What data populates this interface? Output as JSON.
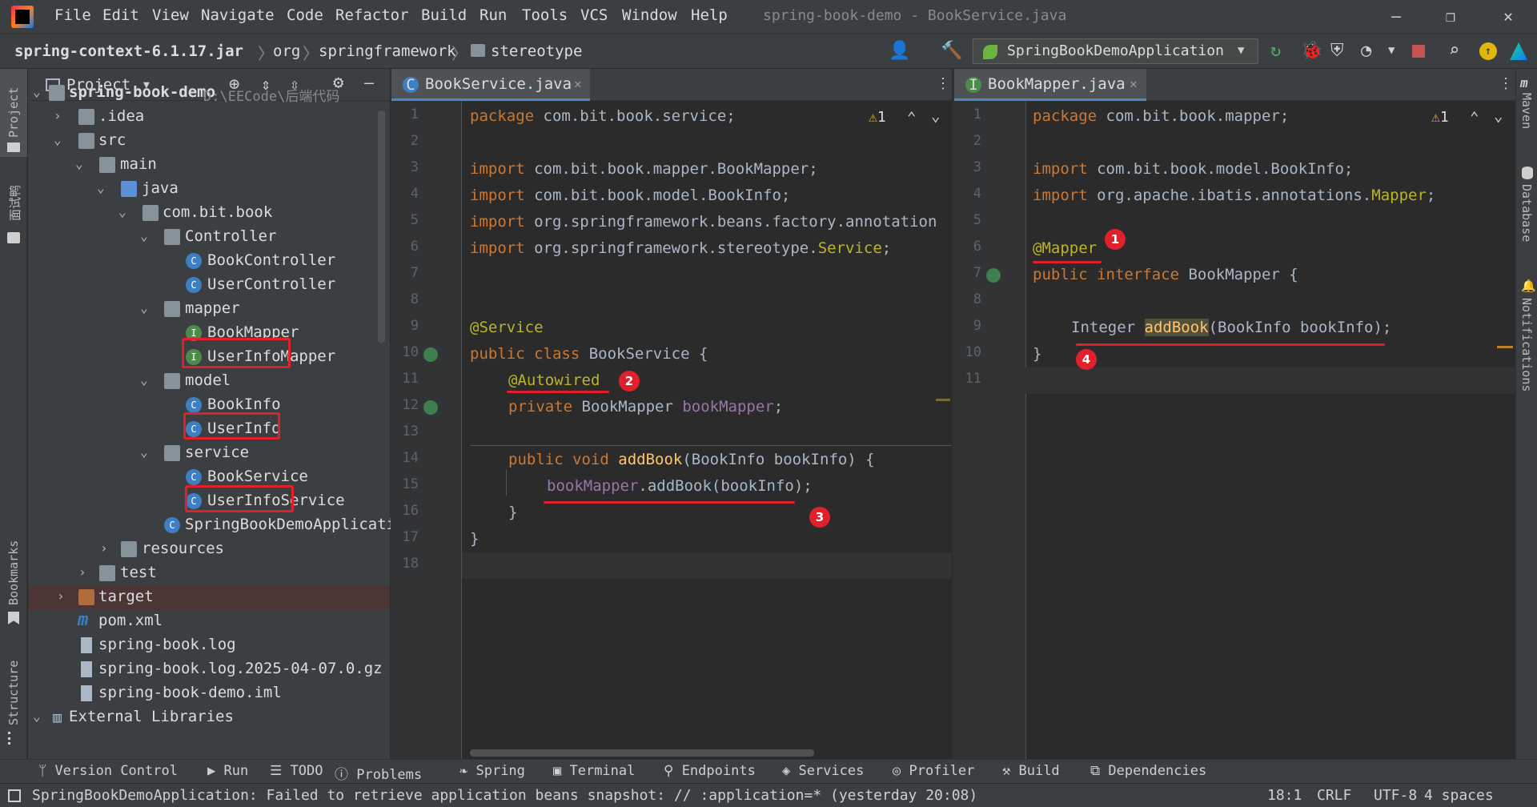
{
  "menu": [
    "File",
    "Edit",
    "View",
    "Navigate",
    "Code",
    "Refactor",
    "Build",
    "Run",
    "Tools",
    "VCS",
    "Window",
    "Help"
  ],
  "window_title": "spring-book-demo - BookService.java",
  "breadcrumb": [
    "spring-context-6.1.17.jar",
    "org",
    "springframework",
    "stereotype"
  ],
  "run_config": "SpringBookDemoApplication",
  "project_panel": {
    "title": "Project",
    "tree": [
      {
        "label": "spring-book-demo",
        "path": "D:\\EECode\\后端代码"
      },
      {
        "label": ".idea"
      },
      {
        "label": "src"
      },
      {
        "label": "main"
      },
      {
        "label": "java"
      },
      {
        "label": "com.bit.book"
      },
      {
        "label": "Controller"
      },
      {
        "label": "BookController"
      },
      {
        "label": "UserController"
      },
      {
        "label": "mapper"
      },
      {
        "label": "BookMapper"
      },
      {
        "label": "UserInfoMapper"
      },
      {
        "label": "model"
      },
      {
        "label": "BookInfo"
      },
      {
        "label": "UserInfo"
      },
      {
        "label": "service"
      },
      {
        "label": "BookService"
      },
      {
        "label": "UserInfoService"
      },
      {
        "label": "SpringBookDemoApplicati"
      },
      {
        "label": "resources"
      },
      {
        "label": "test"
      },
      {
        "label": "target"
      },
      {
        "label": "pom.xml"
      },
      {
        "label": "spring-book.log"
      },
      {
        "label": "spring-book.log.2025-04-07.0.gz"
      },
      {
        "label": "spring-book-demo.iml"
      },
      {
        "label": "External Libraries"
      }
    ]
  },
  "left_editor": {
    "tab": "BookService.java",
    "warnings": "1",
    "line_numbers": [
      "1",
      "2",
      "3",
      "4",
      "5",
      "6",
      "7",
      "8",
      "9",
      "10",
      "11",
      "12",
      "13",
      "14",
      "15",
      "16",
      "17",
      "18"
    ],
    "lines": {
      "l1_kw": "package",
      "l1_rest": " com.bit.book.service;",
      "l3_kw": "import",
      "l3_rest": " com.bit.book.mapper.BookMapper;",
      "l4_kw": "import",
      "l4_rest": " com.bit.book.model.BookInfo;",
      "l5_kw": "import",
      "l5_rest": " org.springframework.beans.factory.annotation",
      "l6_kw": "import",
      "l6_rest": " org.springframework.stereotype.",
      "l6_ann": "Service",
      "l6_end": ";",
      "l9_ann": "@Service",
      "l10_kw": "public class",
      "l10_rest": " BookService {",
      "l11_ann": "@Autowired",
      "l12_kw": "private",
      "l12_type": " BookMapper ",
      "l12_fld": "bookMapper",
      "l12_end": ";",
      "l14_kw": "public void",
      "l14_mth": " addBook",
      "l14_rest": "(BookInfo bookInfo) {",
      "l15_fld": "bookMapper",
      "l15_rest": ".addBook(bookInfo);",
      "l16": "}",
      "l17": "}"
    },
    "badges": [
      "2",
      "3"
    ]
  },
  "right_editor": {
    "tab": "BookMapper.java",
    "warnings": "1",
    "line_numbers": [
      "1",
      "2",
      "3",
      "4",
      "5",
      "6",
      "7",
      "8",
      "9",
      "10",
      "11"
    ],
    "lines": {
      "l1_kw": "package",
      "l1_rest": " com.bit.book.mapper;",
      "l3_kw": "import",
      "l3_rest": " com.bit.book.model.BookInfo;",
      "l4_kw": "import",
      "l4_rest": " org.apache.ibatis.annotations.",
      "l4_ann": "Mapper",
      "l4_end": ";",
      "l6_ann": "@Mapper",
      "l7_kw": "public interface",
      "l7_rest": " BookMapper {",
      "l9_type": "Integer ",
      "l9_mth": "addBook",
      "l9_rest": "(BookInfo bookInfo);",
      "l10": "}"
    },
    "badges": [
      "1",
      "4"
    ]
  },
  "left_stripe": [
    "Project",
    "面试鸭",
    "Bookmarks",
    "Structure"
  ],
  "right_stripe": [
    "Maven",
    "Database",
    "Notifications"
  ],
  "tool_windows": [
    "Version Control",
    "Run",
    "TODO",
    "Problems",
    "Spring",
    "Terminal",
    "Endpoints",
    "Services",
    "Profiler",
    "Build",
    "Dependencies"
  ],
  "status": {
    "message": "SpringBookDemoApplication: Failed to retrieve application beans snapshot: // :application=* (yesterday 20:08)",
    "position": "18:1",
    "line_sep": "CRLF",
    "encoding": "UTF-8",
    "indent": "4 spaces"
  },
  "colors": {
    "accent": "#4a88c7",
    "annotation_red": "#e0202a",
    "keyword": "#cc7832",
    "annotation": "#bbb529",
    "field": "#9876aa",
    "method": "#ffc66d"
  }
}
